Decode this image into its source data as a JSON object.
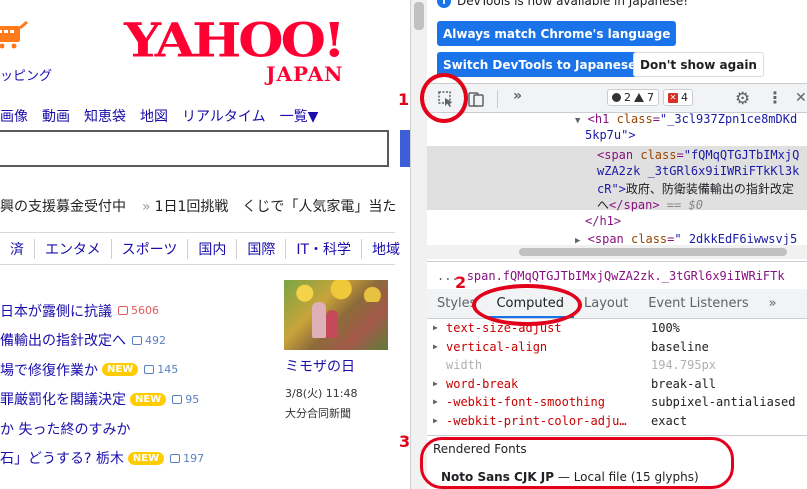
{
  "yahoo": {
    "shop_label": "ッピング",
    "logo": "YAHOO!",
    "logo_sub": "JAPAN",
    "nav": [
      "画像",
      "動画",
      "知恵袋",
      "地図",
      "リアルタイム",
      "一覧▼"
    ],
    "ticker": {
      "a": "興の支援募金受付中",
      "b": "1日1回挑戦　くじで「人気家電」当た"
    },
    "tabs": [
      "済",
      "エンタメ",
      "スポーツ",
      "国内",
      "国際",
      "IT・科学",
      "地域"
    ],
    "news": [
      {
        "text": "日本が露側に抗議",
        "count": "5606",
        "hot": true,
        "new": false
      },
      {
        "text": "備輸出の指針改定へ",
        "count": "492",
        "hot": false,
        "new": false
      },
      {
        "text": "場で修復作業か",
        "count": "145",
        "hot": false,
        "new": true
      },
      {
        "text": "罪厳罰化を閣議決定",
        "count": "95",
        "hot": false,
        "new": true
      },
      {
        "text": "か 失った終のすみか",
        "count": "",
        "hot": false,
        "new": false
      },
      {
        "text": "石」どうする? 栃木",
        "count": "197",
        "hot": false,
        "new": true
      }
    ],
    "new_label": "NEW",
    "photo": {
      "title": "ミモザの日",
      "date": "3/8(火) 11:48",
      "source": "大分合同新聞"
    }
  },
  "devtools": {
    "info": "DevTools is now available in Japanese!",
    "btn_match": "Always match Chrome's language",
    "btn_switch": "Switch DevTools to Japanese",
    "btn_dont": "Don't show again",
    "toolbar": {
      "chevron": "»",
      "errors": "2",
      "warnings": "7",
      "issues": "4"
    },
    "elements": {
      "l1_tag": "<h1 ",
      "l1_attr": "class",
      "l1_val": "\"_3cl937Zpn1ce8mDKd",
      "l2": "5kp7u\">",
      "l3_tag": "<span ",
      "l3_attr": "class",
      "l3_val": "\"fQMqQTGJTbIMxjQ",
      "l4": "wZA2zk _3tGRl6x9iIWRiFTkKl3k",
      "l5_val": "cR\">",
      "l5_txt": "政府、防衛装備輸出の指針改定",
      "l6_txt": "へ",
      "l6_tag": "</span>",
      "l6_cmt": "== $0",
      "l7": "</h1>",
      "l8_tag": "<span ",
      "l8_attr": "class",
      "l8_val": "\"_2dkkEdF6iwwsvj5"
    },
    "crumb": {
      "dots": "...",
      "path": "span.fQMqQTGJTbIMxjQwZA2zk._3tGRl6x9iIWRiFTk"
    },
    "panel_tabs": [
      "Styles",
      "Computed",
      "Layout",
      "Event Listeners",
      "»"
    ],
    "props": [
      {
        "name": "text-size-adjust",
        "value": "100%",
        "dim": false
      },
      {
        "name": "vertical-align",
        "value": "baseline",
        "dim": false
      },
      {
        "name": "width",
        "value": "194.795px",
        "dim": true
      },
      {
        "name": "word-break",
        "value": "break-all",
        "dim": false
      },
      {
        "name": "-webkit-font-smoothing",
        "value": "subpixel-antialiased",
        "dim": false
      },
      {
        "name": "-webkit-print-color-adju…",
        "value": "exact",
        "dim": false
      }
    ],
    "rendered_title": "Rendered Fonts",
    "rendered_font_name": "Noto Sans CJK JP",
    "rendered_font_sep": " — ",
    "rendered_font_detail": "Local file (15 glyphs)"
  },
  "annotations": {
    "n1": "1",
    "n2": "2",
    "n3": "3"
  },
  "colors": {
    "yahoo_red": "#ff0033",
    "devtools_blue": "#1a73e8",
    "annotation_red": "#e3001b"
  }
}
